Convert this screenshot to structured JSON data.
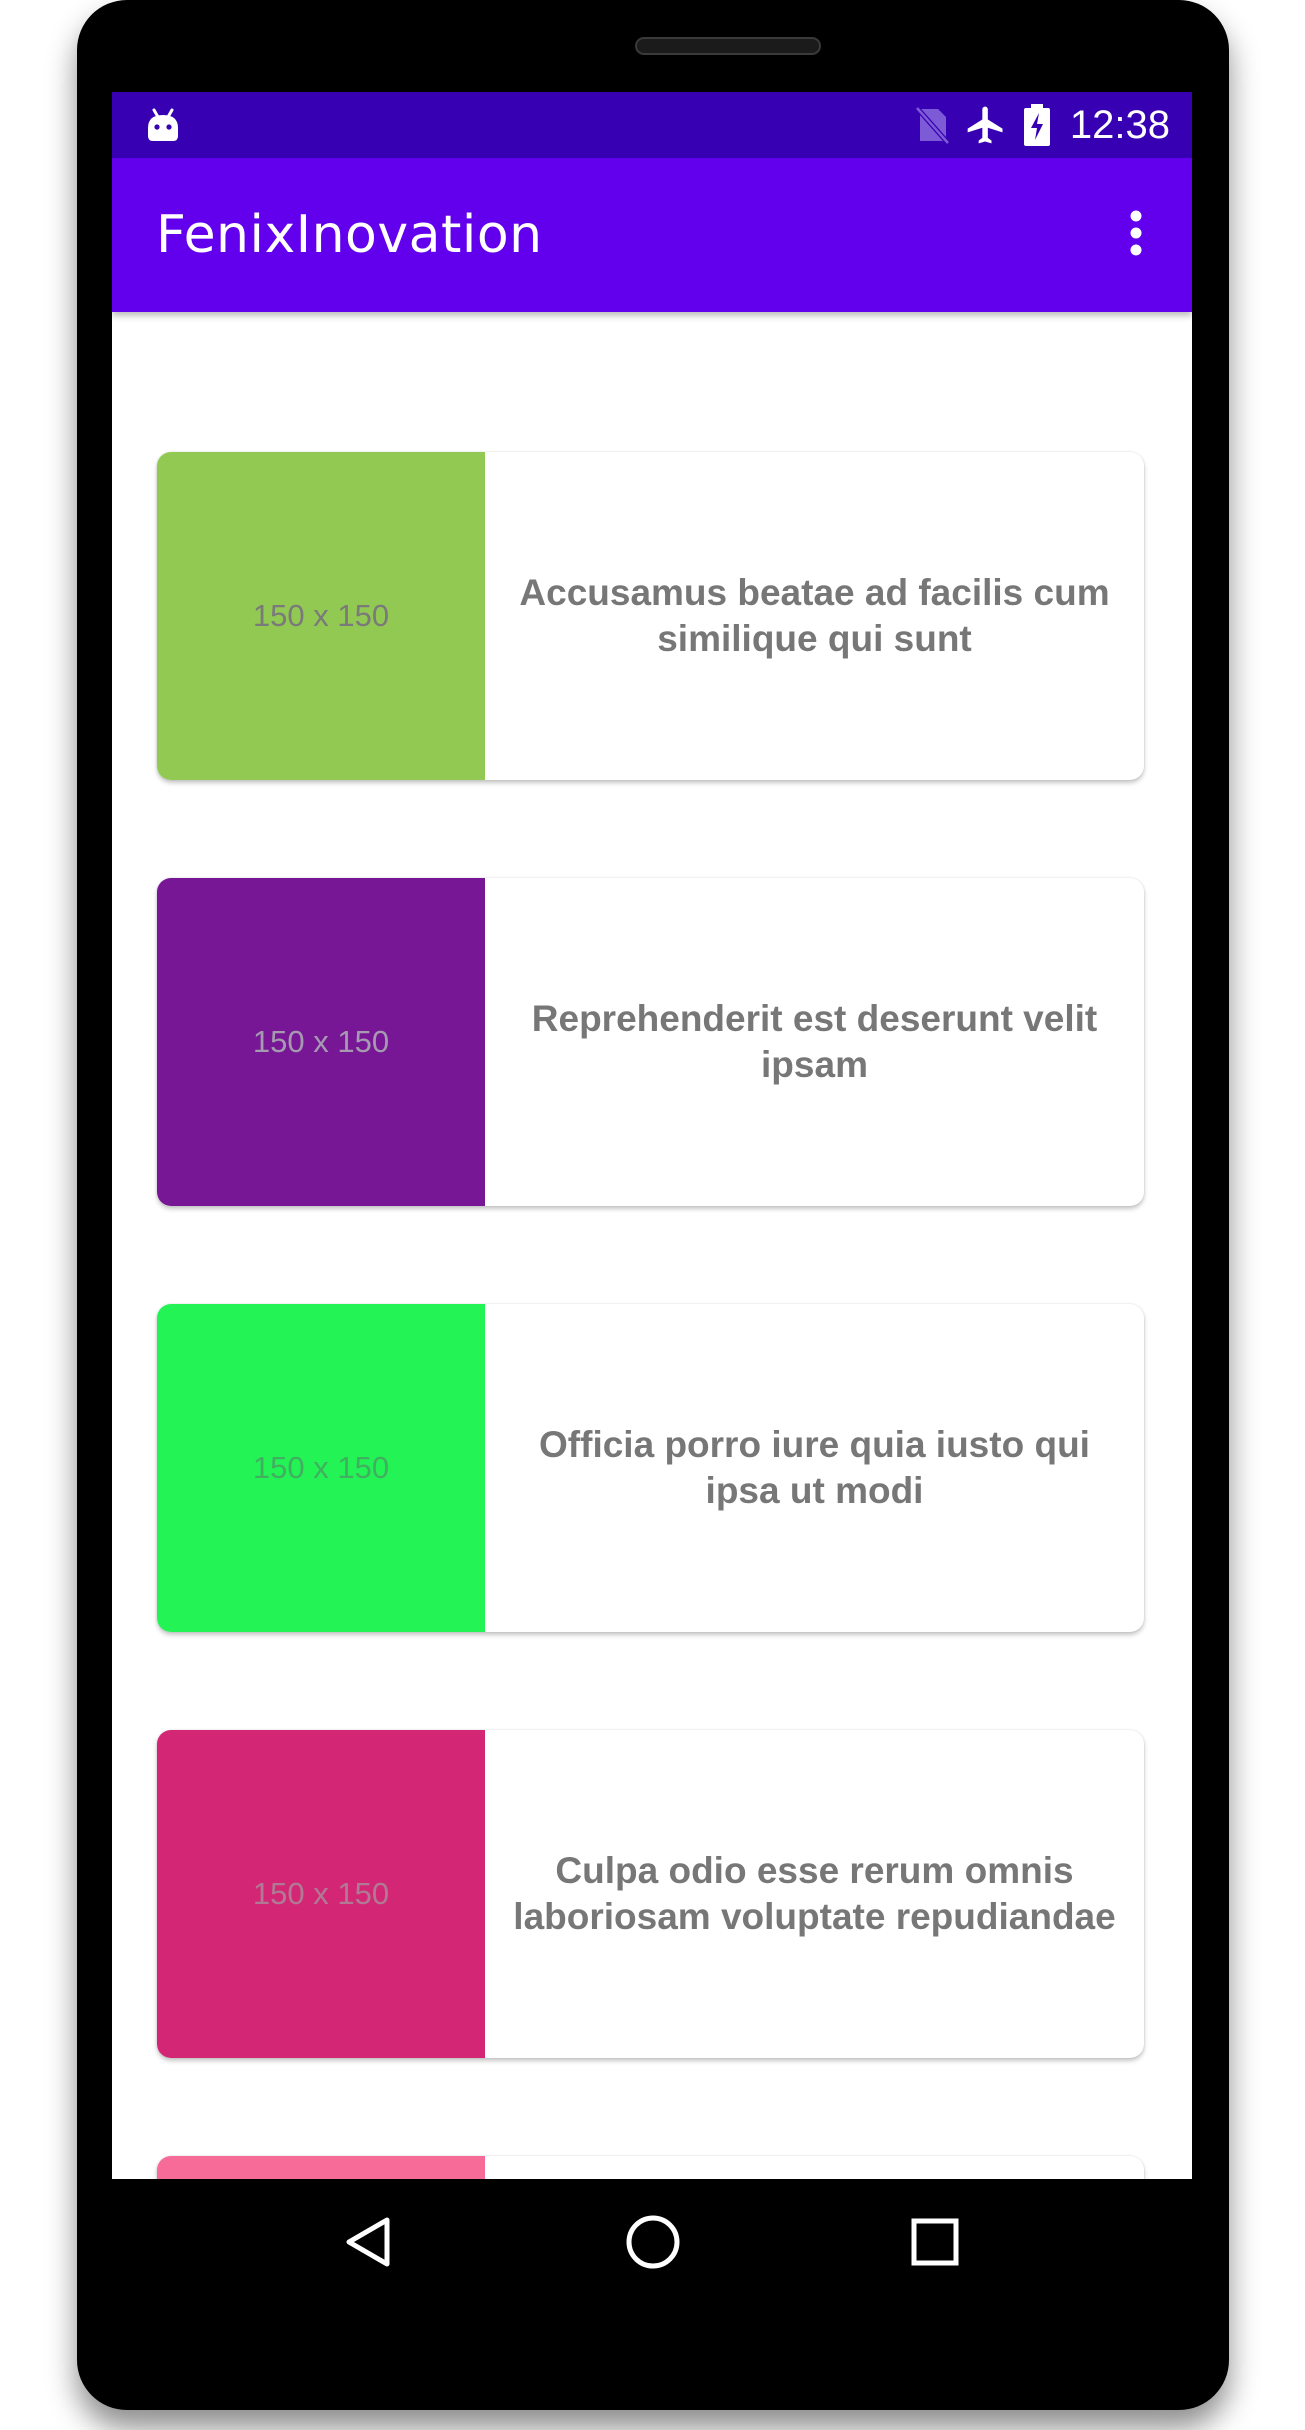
{
  "status_bar": {
    "time": "12:38",
    "icons": [
      "android-debug-icon",
      "no-sim-icon",
      "airplane-mode-icon",
      "battery-charging-icon"
    ]
  },
  "app_bar": {
    "title": "FenixInovation",
    "menu_icon": "more-vert-icon"
  },
  "cards": [
    {
      "thumb_label": "150 x 150",
      "thumb_color": "#92c952",
      "thumb_text_color": "#7a7a7a",
      "title": "Accusamus beatae ad facilis cum similique qui sunt"
    },
    {
      "thumb_label": "150 x 150",
      "thumb_color": "#771796",
      "thumb_text_color": "#a59ab0",
      "title": "Reprehenderit est deserunt velit ipsam"
    },
    {
      "thumb_label": "150 x 150",
      "thumb_color": "#24f355",
      "thumb_text_color": "#40b060",
      "title": "Officia porro iure quia iusto qui ipsa ut modi"
    },
    {
      "thumb_label": "150 x 150",
      "thumb_color": "#d32776",
      "thumb_text_color": "#b07a94",
      "title": "Culpa odio esse rerum omnis laboriosam voluptate repudiandae"
    },
    {
      "thumb_label": "",
      "thumb_color": "#f66b97",
      "thumb_text_color": "#b07a94",
      "title": ""
    }
  ],
  "nav_bar": {
    "back_icon": "back-triangle-icon",
    "home_icon": "home-circle-icon",
    "recents_icon": "recents-square-icon"
  },
  "colors": {
    "status_bar": "#3700b3",
    "app_bar": "#6200ee",
    "card_text": "#777777"
  }
}
